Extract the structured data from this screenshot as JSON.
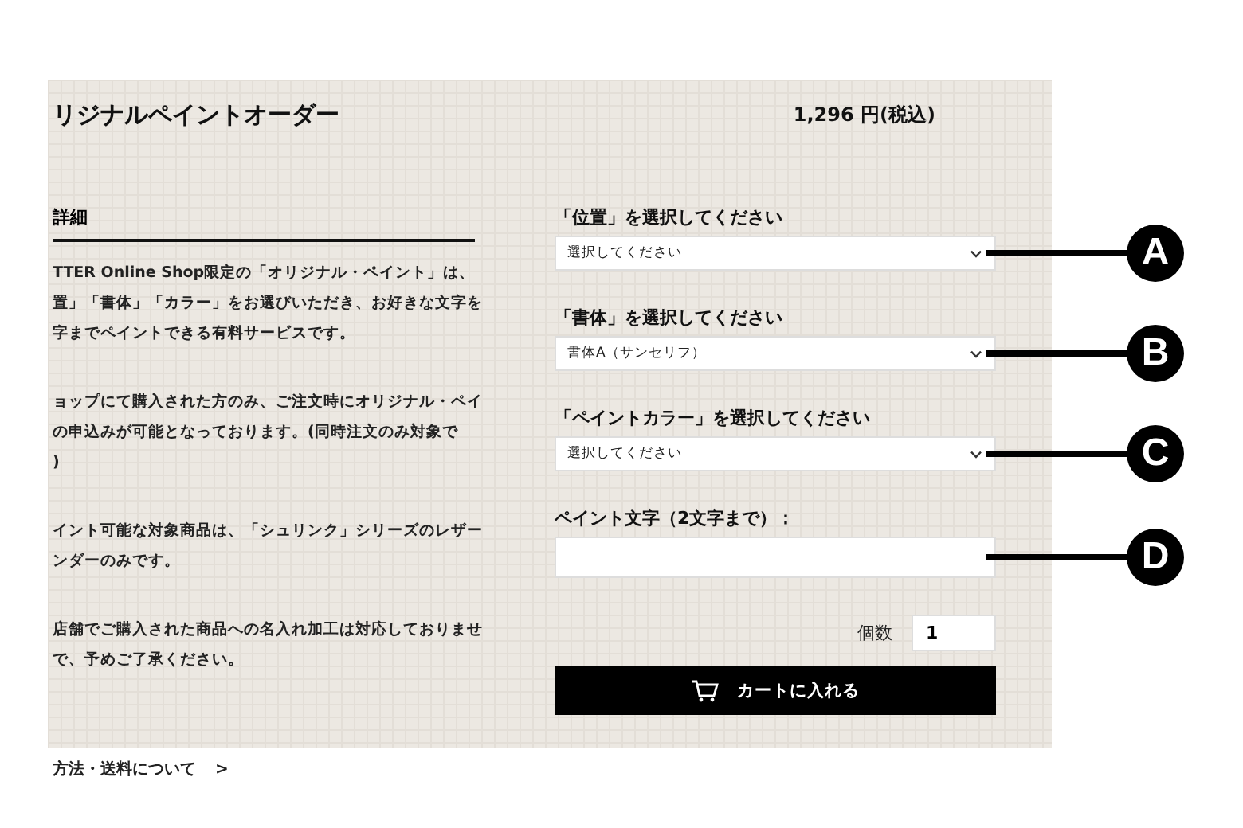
{
  "title": "リジナルペイントオーダー",
  "price": "1,296 円(税込)",
  "details": {
    "heading": "詳細",
    "paragraphs": [
      [
        "TTER Online Shop限定の「オリジナル・ペイント」は、",
        "置」「書体」「カラー」をお選びいただき、お好きな文字を",
        "字までペイントできる有料サービスです。"
      ],
      [
        "ョップにて購入された方のみ、ご注文時にオリジナル・ペイ",
        "の申込みが可能となっております。(同時注文のみ対象で",
        ")"
      ],
      [
        "イント可能な対象商品は、「シュリンク」シリーズのレザー",
        "ンダーのみです。"
      ],
      [
        "店舗でご購入された商品への名入れ加工は対応しておりませ",
        "で、予めご了承ください。"
      ]
    ]
  },
  "link": {
    "label": "方法・送料について",
    "chevron": ">"
  },
  "fields": [
    {
      "kind": "select",
      "label": "「位置」を選択してください",
      "value": "選択してください",
      "callout": "A"
    },
    {
      "kind": "select",
      "label": "「書体」を選択してください",
      "value": "書体A（サンセリフ）",
      "callout": "B"
    },
    {
      "kind": "select",
      "label": "「ペイントカラー」を選択してください",
      "value": "選択してください",
      "callout": "C"
    },
    {
      "kind": "text",
      "label": "ペイント文字（2文字まで）：",
      "callout": "D"
    }
  ],
  "quantity": {
    "label": "個数",
    "value": "1"
  },
  "cart_button": "カートに入れる"
}
